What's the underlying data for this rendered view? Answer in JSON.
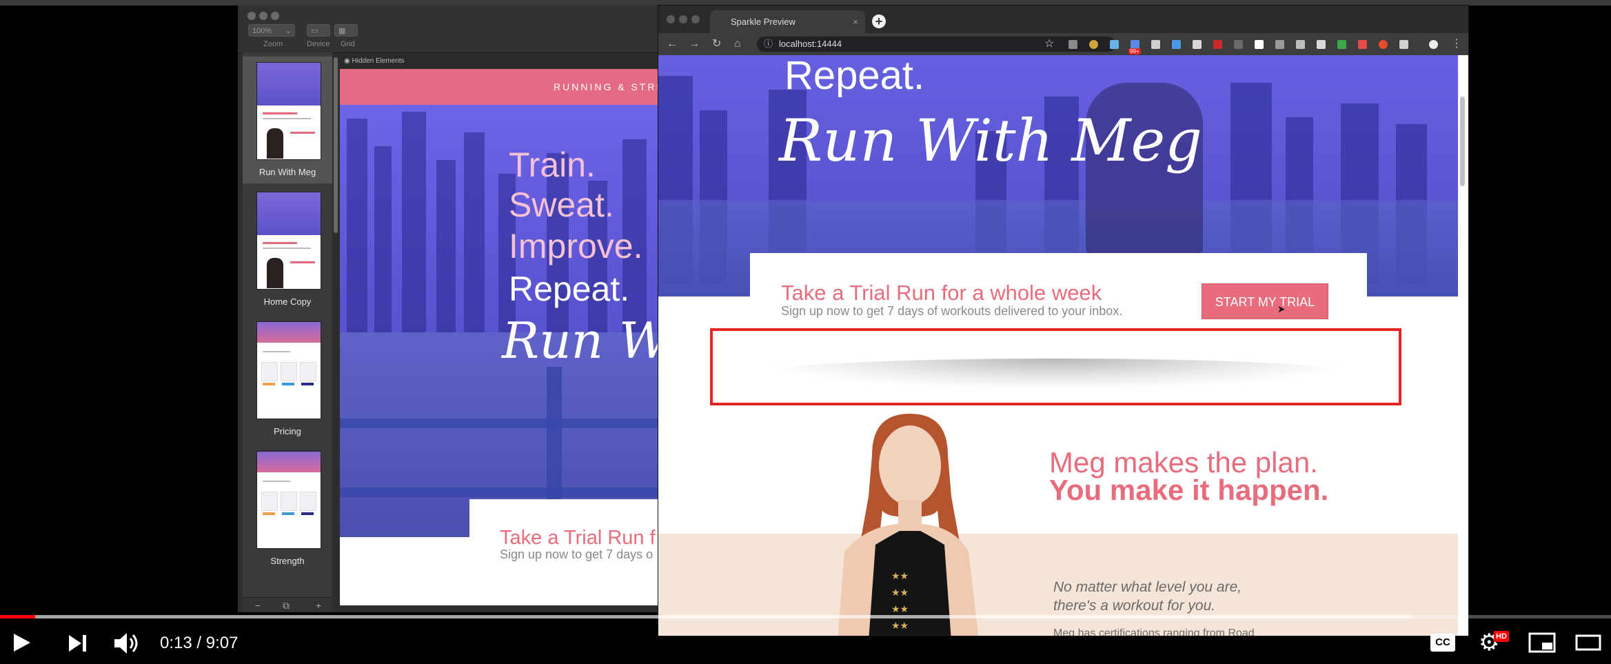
{
  "player": {
    "time_current": "0:13",
    "time_total": "9:07",
    "time_separator": "/",
    "progress_fraction": 0.022,
    "cc_label": "CC",
    "hd_badge": "HD"
  },
  "app": {
    "toolbar": {
      "zoom_value": "100%",
      "labels": [
        "Zoom",
        "Device",
        "Grid"
      ]
    },
    "pages": [
      {
        "label": "Run With Meg",
        "selected": true
      },
      {
        "label": "Home Copy",
        "selected": false
      },
      {
        "label": "Pricing",
        "selected": false
      },
      {
        "label": "Strength",
        "selected": false
      }
    ],
    "hidden_elements_label": "Hidden Elements",
    "canvas": {
      "banner_text": "RUNNING & STREN",
      "hero_lines": [
        "Train.",
        "Sweat.",
        "Improve.",
        "Repeat."
      ],
      "script_text": "Run Wi",
      "trial_title": "Take a Trial Run f",
      "trial_sub": "Sign up now to get 7 days o"
    },
    "bottom_buttons": [
      "−",
      "⧉",
      "+"
    ]
  },
  "browser": {
    "tab_title": "Sparkle Preview",
    "url": "localhost:14444",
    "ext_badge": "99+",
    "page": {
      "hero_repeat": "Repeat.",
      "hero_script": "Run With Meg",
      "trial_title": "Take a Trial Run for a whole week",
      "trial_sub": "Sign up now to get 7 days of workouts delivered to your inbox.",
      "start_button": "START MY TRIAL",
      "meg_line1": "Meg makes the plan.",
      "meg_line2": "You make it happen.",
      "quote_line1": "No matter what level you are,",
      "quote_line2": "there's a workout for you.",
      "cert_text": "Meg has certifications ranging from Road"
    }
  },
  "colors": {
    "accent_pink": "#e86c7c",
    "hero_purple": "#5f5ad8",
    "highlight_red": "#e52521",
    "progress_red": "#ff0000"
  }
}
